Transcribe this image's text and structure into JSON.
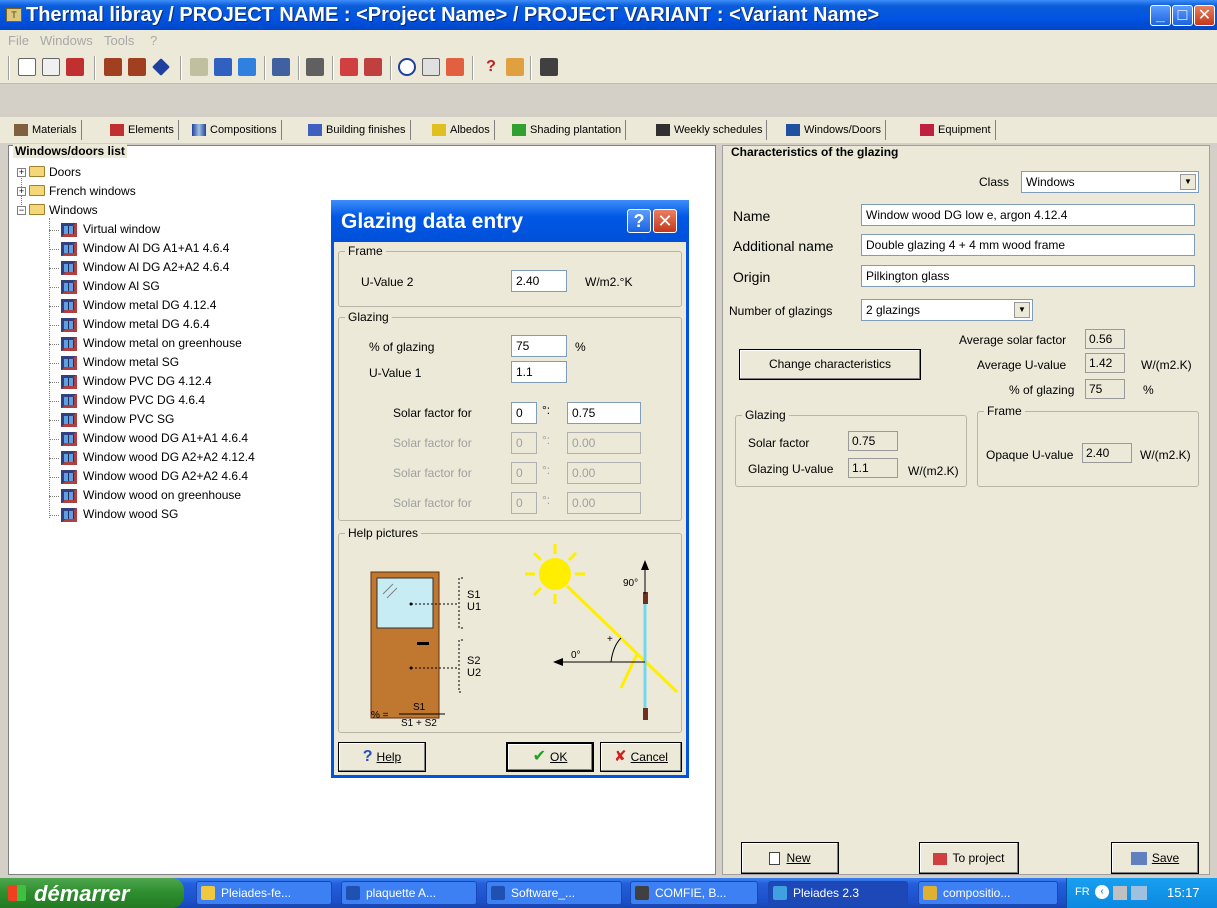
{
  "window": {
    "title": "Thermal libray  /  PROJECT NAME : <Project Name>  /  PROJECT VARIANT : <Variant Name>"
  },
  "menu": [
    "File",
    "Windows",
    "Tools",
    "?"
  ],
  "tabs": [
    {
      "label": "Materials",
      "icon": "materials-icon"
    },
    {
      "label": "Elements",
      "icon": "elements-icon"
    },
    {
      "label": "Compositions",
      "icon": "compositions-icon"
    },
    {
      "label": "Building finishes",
      "icon": "brush-icon"
    },
    {
      "label": "Albedos",
      "icon": "albedo-icon"
    },
    {
      "label": "Shading plantation",
      "icon": "plant-icon"
    },
    {
      "label": "Weekly schedules",
      "icon": "schedule-icon"
    },
    {
      "label": "Windows/Doors",
      "icon": "window-icon"
    },
    {
      "label": "Equipment",
      "icon": "equipment-icon"
    }
  ],
  "tree": {
    "title": "Windows/doors list",
    "folders": [
      {
        "label": "Doors",
        "expanded": false
      },
      {
        "label": "French windows",
        "expanded": false
      },
      {
        "label": "Windows",
        "expanded": true
      }
    ],
    "windows": [
      "Virtual window",
      "Window Al DG A1+A1 4.6.4",
      "Window Al DG A2+A2 4.6.4",
      "Window Al SG",
      "Window metal DG 4.12.4",
      "Window metal DG 4.6.4",
      "Window metal on greenhouse",
      "Window metal SG",
      "Window PVC DG 4.12.4",
      "Window PVC DG 4.6.4",
      "Window PVC SG",
      "Window wood DG A1+A1 4.6.4",
      "Window wood DG A2+A2 4.12.4",
      "Window wood DG A2+A2 4.6.4",
      "Window wood on greenhouse",
      "Window wood SG"
    ]
  },
  "characteristics": {
    "title": "Characteristics of the glazing",
    "class_label": "Class",
    "class_value": "Windows",
    "name_label": "Name",
    "name_value": "Window wood DG low e, argon 4.12.4",
    "additional_label": "Additional name",
    "additional_value": "Double glazing 4 + 4 mm wood frame",
    "origin_label": "Origin",
    "origin_value": "Pilkington glass",
    "num_glazings_label": "Number of glazings",
    "num_glazings_value": "2 glazings",
    "avg_solar_label": "Average solar factor",
    "avg_solar_value": "0.56",
    "avg_u_label": "Average U-value",
    "avg_u_value": "1.42",
    "avg_u_unit": "W/(m2.K)",
    "pct_label": "% of glazing",
    "pct_value": "75",
    "pct_unit": "%",
    "change_button": "Change characteristics",
    "glazing_group": "Glazing",
    "solar_factor_label": "Solar factor",
    "solar_factor_value": "0.75",
    "glazing_u_label": "Glazing U-value",
    "glazing_u_value": "1.1",
    "glazing_u_unit": "W/(m2.K)",
    "frame_group": "Frame",
    "opaque_u_label": "Opaque U-value",
    "opaque_u_value": "2.40",
    "opaque_u_unit": "W/(m2.K)",
    "new_button": "New",
    "toproject_button": "To project",
    "save_button": "Save"
  },
  "dialog": {
    "title": "Glazing data entry",
    "frame_group": "Frame",
    "u2_label": "U-Value 2",
    "u2_value": "2.40",
    "u2_unit": "W/m2.°K",
    "glazing_group": "Glazing",
    "pct_label": "% of glazing",
    "pct_value": "75",
    "pct_unit": "%",
    "u1_label": "U-Value 1",
    "u1_value": "1.1",
    "solar_rows": [
      {
        "label": "Solar factor for",
        "angle": "0",
        "value": "0.75",
        "enabled": true
      },
      {
        "label": "Solar factor for",
        "angle": "0",
        "value": "0.00",
        "enabled": false
      },
      {
        "label": "Solar factor for",
        "angle": "0",
        "value": "0.00",
        "enabled": false
      },
      {
        "label": "Solar factor for",
        "angle": "0",
        "value": "0.00",
        "enabled": false
      }
    ],
    "degree_sign": "°:",
    "help_group": "Help pictures",
    "pic_s1": "S1",
    "pic_u1": "U1",
    "pic_s2": "S2",
    "pic_u2": "U2",
    "pic_formula_lhs": "% =",
    "pic_formula_num": "S1",
    "pic_formula_den": "S1 + S2",
    "pic_90": "90°",
    "pic_0": "0°",
    "pic_plus": "+",
    "help_button": "Help",
    "ok_button": "OK",
    "cancel_button": "Cancel"
  },
  "taskbar": {
    "start": "démarrer",
    "tasks": [
      "Pleiades-fe...",
      "plaquette A...",
      "Software_...",
      "COMFIE, B...",
      "Pleiades 2.3",
      "compositio..."
    ],
    "lang": "FR",
    "clock": "15:17"
  }
}
